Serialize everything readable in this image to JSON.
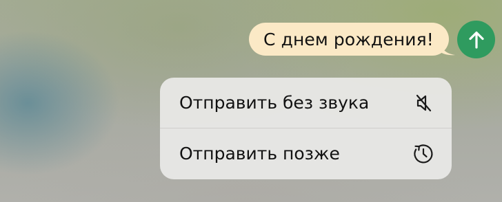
{
  "message": {
    "text": "С днем рождения!",
    "bubble_color": "#fbe9c6"
  },
  "send_button": {
    "icon": "arrow-up-icon",
    "color": "#2f9b5f"
  },
  "send_menu": {
    "items": [
      {
        "label": "Отправить без звука",
        "icon": "mute-speaker-icon"
      },
      {
        "label": "Отправить позже",
        "icon": "schedule-clock-icon"
      }
    ]
  }
}
